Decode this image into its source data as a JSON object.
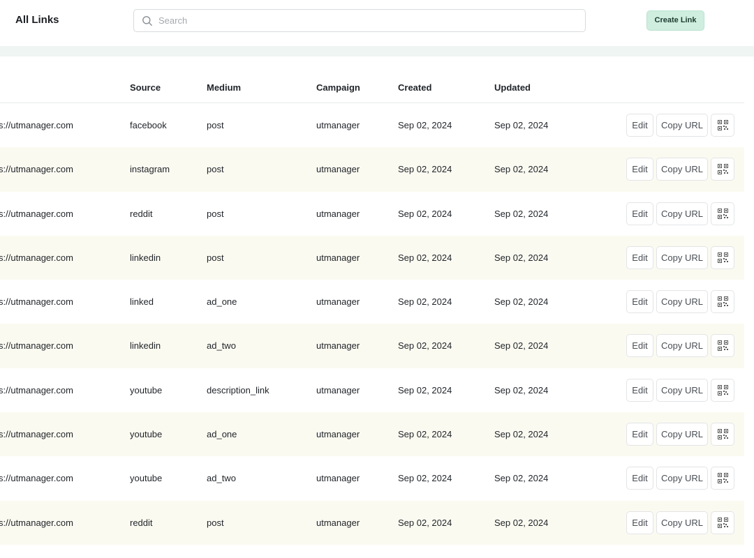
{
  "header": {
    "title": "All Links",
    "search_placeholder": "Search",
    "create_label": "Create Link"
  },
  "table": {
    "columns": [
      "Source",
      "Medium",
      "Campaign",
      "Created",
      "Updated"
    ],
    "rows": [
      {
        "url": "s://utmanager.com",
        "source": "facebook",
        "medium": "post",
        "campaign": "utmanager",
        "created": "Sep 02, 2024",
        "updated": "Sep 02, 2024"
      },
      {
        "url": "s://utmanager.com",
        "source": "instagram",
        "medium": "post",
        "campaign": "utmanager",
        "created": "Sep 02, 2024",
        "updated": "Sep 02, 2024"
      },
      {
        "url": "s://utmanager.com",
        "source": "reddit",
        "medium": "post",
        "campaign": "utmanager",
        "created": "Sep 02, 2024",
        "updated": "Sep 02, 2024"
      },
      {
        "url": "s://utmanager.com",
        "source": "linkedin",
        "medium": "post",
        "campaign": "utmanager",
        "created": "Sep 02, 2024",
        "updated": "Sep 02, 2024"
      },
      {
        "url": "s://utmanager.com",
        "source": "linked",
        "medium": "ad_one",
        "campaign": "utmanager",
        "created": "Sep 02, 2024",
        "updated": "Sep 02, 2024"
      },
      {
        "url": "s://utmanager.com",
        "source": "linkedin",
        "medium": "ad_two",
        "campaign": "utmanager",
        "created": "Sep 02, 2024",
        "updated": "Sep 02, 2024"
      },
      {
        "url": "s://utmanager.com",
        "source": "youtube",
        "medium": "description_link",
        "campaign": "utmanager",
        "created": "Sep 02, 2024",
        "updated": "Sep 02, 2024"
      },
      {
        "url": "s://utmanager.com",
        "source": "youtube",
        "medium": "ad_one",
        "campaign": "utmanager",
        "created": "Sep 02, 2024",
        "updated": "Sep 02, 2024"
      },
      {
        "url": "s://utmanager.com",
        "source": "youtube",
        "medium": "ad_two",
        "campaign": "utmanager",
        "created": "Sep 02, 2024",
        "updated": "Sep 02, 2024"
      },
      {
        "url": "s://utmanager.com",
        "source": "reddit",
        "medium": "post",
        "campaign": "utmanager",
        "created": "Sep 02, 2024",
        "updated": "Sep 02, 2024"
      }
    ],
    "actions": {
      "edit": "Edit",
      "copy": "Copy URL",
      "qr_icon": "qr-code-icon"
    }
  },
  "colors": {
    "accent": "#cfeee0",
    "band": "#eef5f2",
    "row_alt": "#fbfaf1",
    "border": "#e3e4e6"
  }
}
